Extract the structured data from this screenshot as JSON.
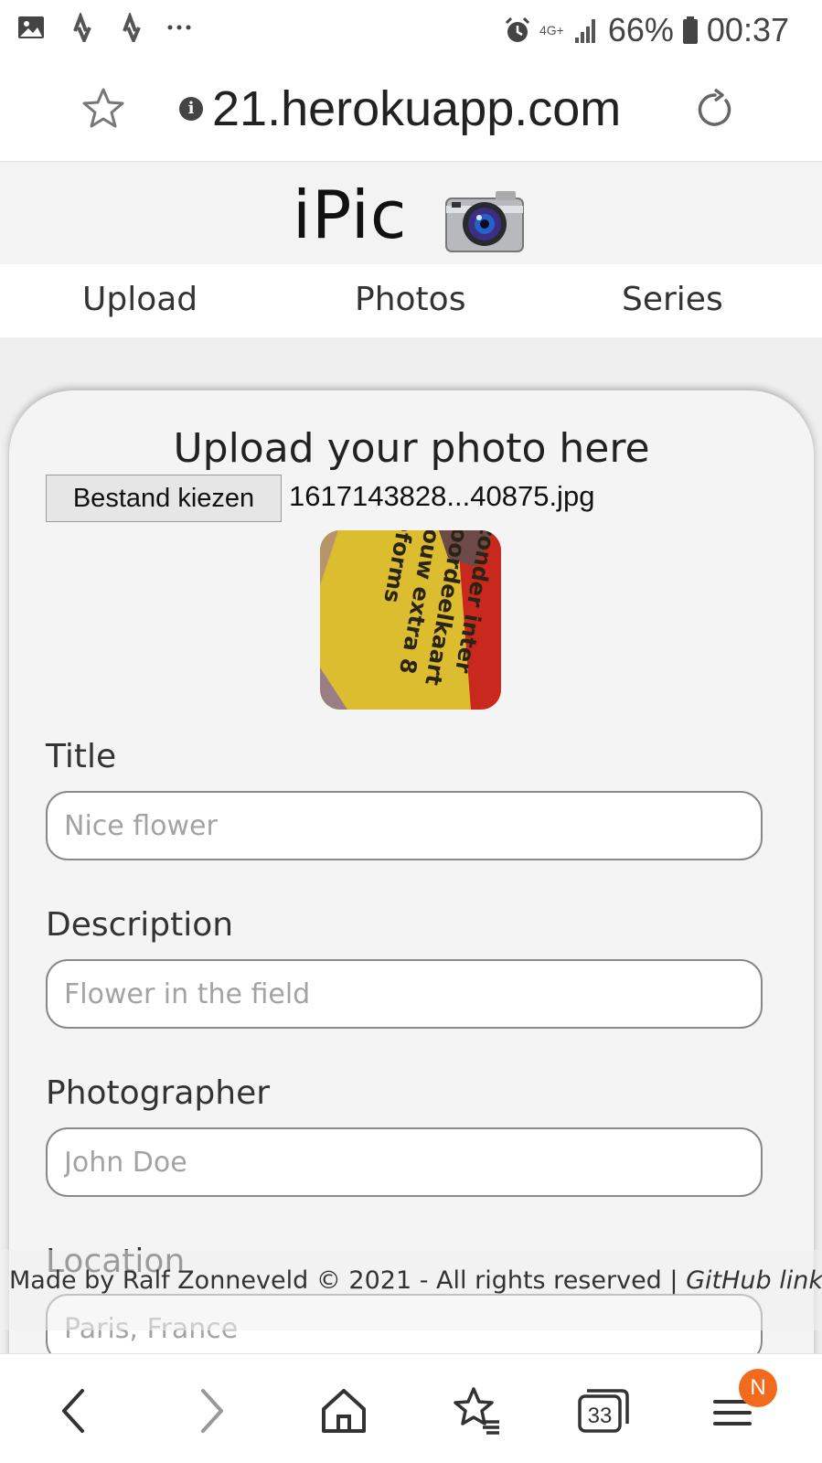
{
  "status_bar": {
    "network": "4G+",
    "battery": "66%",
    "time": "00:37",
    "left_icons": [
      "gallery-icon",
      "strava-icon",
      "strava-icon",
      "more-icon"
    ]
  },
  "browser": {
    "url": "21.herokuapp.com",
    "tab_count": "33",
    "menu_badge": "N"
  },
  "app": {
    "name": "iPic",
    "nav": [
      "Upload",
      "Photos",
      "Series"
    ]
  },
  "upload": {
    "heading": "Upload your photo here",
    "file_button": "Bestand kiezen",
    "file_name": "1617143828...40875.jpg",
    "fields": [
      {
        "label": "Title",
        "placeholder": "Nice flower"
      },
      {
        "label": "Description",
        "placeholder": "Flower in the field"
      },
      {
        "label": "Photographer",
        "placeholder": "John Doe"
      },
      {
        "label": "Location",
        "placeholder": "Paris, France"
      }
    ]
  },
  "footer": {
    "text": "Made by Ralf Zonneveld © 2021 - All rights reserved | ",
    "link": "GitHub link"
  },
  "colors": {
    "accent_badge": "#f26a1b",
    "page_bg": "#efefef",
    "card_bg": "#f4f4f4"
  }
}
